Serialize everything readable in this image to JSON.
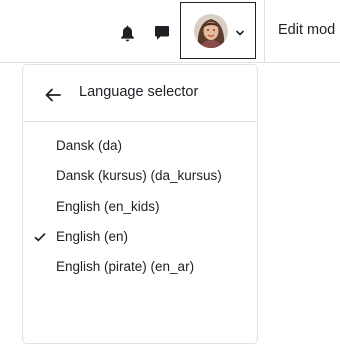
{
  "header": {
    "notifications_icon": "bell-icon",
    "messages_icon": "chat-bubble-icon",
    "user_menu_icon": "chevron-down-icon",
    "edit_mode_label": "Edit mod"
  },
  "language_menu": {
    "back_icon": "arrow-left-icon",
    "title": "Language selector",
    "items": [
      {
        "label": "Dansk (da)",
        "selected": false
      },
      {
        "label": "Dansk (kursus) (da_kursus)",
        "selected": false
      },
      {
        "label": "English (en_kids)",
        "selected": false
      },
      {
        "label": "English (en)",
        "selected": true
      },
      {
        "label": "English (pirate) (en_ar)",
        "selected": false
      }
    ]
  },
  "colors": {
    "text": "#1d2125",
    "border": "#dee2e6",
    "focus_outline": "#1d2125"
  }
}
